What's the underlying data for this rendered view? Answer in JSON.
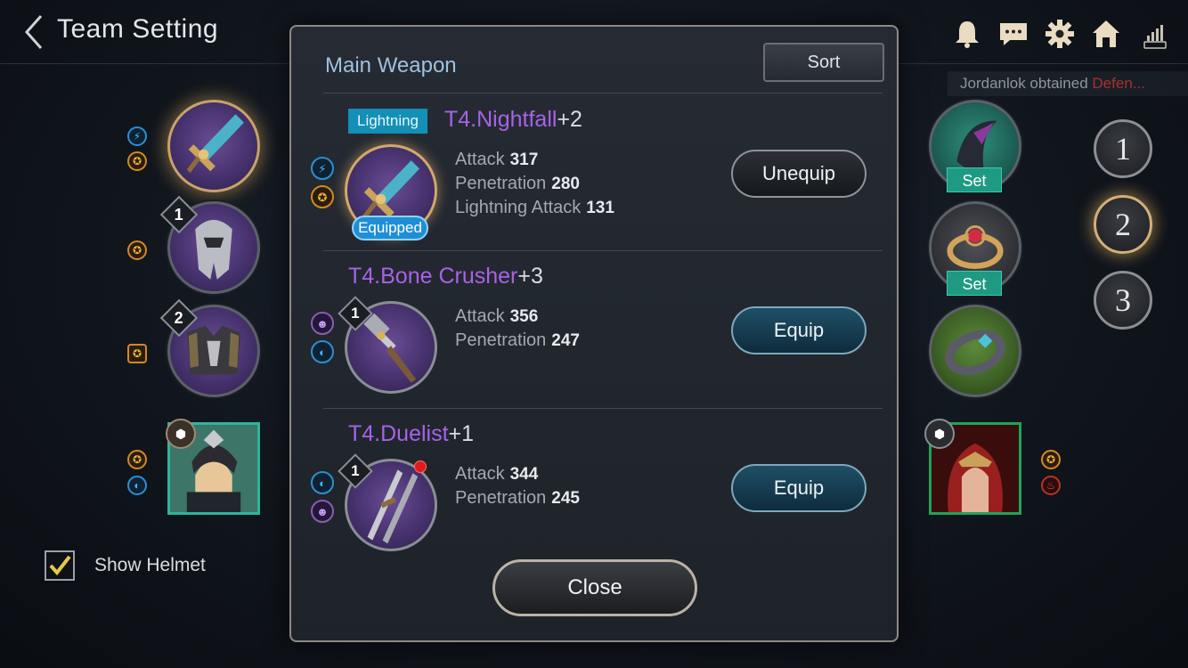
{
  "header": {
    "title": "Team Setting",
    "icons": [
      "bell-icon",
      "chat-icon",
      "gear-icon",
      "home-icon",
      "signal-icon"
    ]
  },
  "notice": {
    "prefix": "Jordanlok obtained",
    "highlight": "Defen..."
  },
  "left_slots": [
    {
      "name": "weapon-slot",
      "badge": null
    },
    {
      "name": "helmet-slot",
      "badge": "1"
    },
    {
      "name": "armor-slot",
      "badge": "2"
    }
  ],
  "right_slots": [
    {
      "name": "cloak-slot",
      "tag": "Set"
    },
    {
      "name": "ring-slot",
      "tag": "Set"
    },
    {
      "name": "bracelet-slot",
      "tag": null
    }
  ],
  "presets": [
    "1",
    "2",
    "3"
  ],
  "active_preset": "2",
  "show_helmet": {
    "label": "Show Helmet",
    "checked": true
  },
  "modal": {
    "title": "Main Weapon",
    "sort_label": "Sort",
    "close_label": "Close",
    "items": [
      {
        "element": "Lightning",
        "name": "T4.Nightfall",
        "plus": "+2",
        "equipped_label": "Equipped",
        "badge": null,
        "stats": [
          {
            "label": "Attack",
            "value": "317"
          },
          {
            "label": "Penetration",
            "value": "280"
          },
          {
            "label": "Lightning Attack",
            "value": "131"
          }
        ],
        "button": "Unequip"
      },
      {
        "element": null,
        "name": "T4.Bone Crusher",
        "plus": "+3",
        "badge": "1",
        "stats": [
          {
            "label": "Attack",
            "value": "356"
          },
          {
            "label": "Penetration",
            "value": "247"
          }
        ],
        "button": "Equip"
      },
      {
        "element": null,
        "name": "T4.Duelist",
        "plus": "+1",
        "badge": "1",
        "stats": [
          {
            "label": "Attack",
            "value": "344"
          },
          {
            "label": "Penetration",
            "value": "245"
          }
        ],
        "button": "Equip"
      }
    ]
  }
}
